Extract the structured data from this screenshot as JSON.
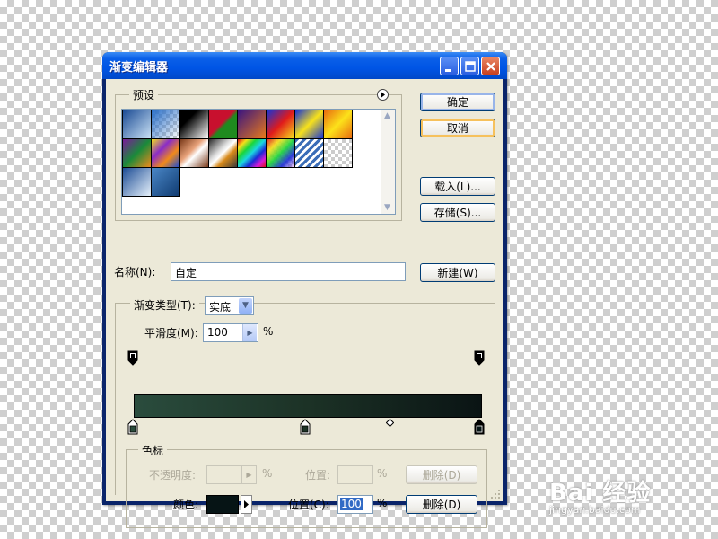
{
  "window": {
    "title": "渐变编辑器",
    "controls": [
      "minimize",
      "maximize",
      "close"
    ]
  },
  "presets": {
    "group_label": "预设",
    "menu_icon": "right-arrow-circle-icon",
    "swatches": [
      "blue-white",
      "transparent-checker",
      "black-white",
      "red-green",
      "violet-orange",
      "blue-red-yellow",
      "blue-yellow-blue",
      "orange-yellow-orange",
      "violet-green-orange",
      "yellow-violet-orange-blue",
      "copper",
      "chrome",
      "spectrum",
      "transparent-rainbow",
      "transparent-stripes",
      "blue-checker",
      "blue-white-2",
      "steel-blue"
    ]
  },
  "buttons": {
    "ok": "确定",
    "cancel": "取消",
    "load": "载入(L)...",
    "save": "存储(S)...",
    "new": "新建(W)"
  },
  "name": {
    "label": "名称(N):",
    "value": "自定"
  },
  "gradient": {
    "type_label": "渐变类型(T):",
    "type_value": "实底",
    "smoothness_label": "平滑度(M):",
    "smoothness_value": "100",
    "smoothness_unit": "%",
    "colors": {
      "start": "#2a4c3d",
      "mid": "#1c3226",
      "end": "#0a1414"
    }
  },
  "color_stops": {
    "group_label": "色标",
    "opacity_label": "不透明度:",
    "opacity_value": "",
    "opacity_unit": "%",
    "opacity_location_label": "位置:",
    "opacity_location_value": "",
    "opacity_location_unit": "%",
    "opacity_delete": "删除(D)",
    "color_label": "颜色:",
    "color_value": "#061415",
    "location_label": "位置(C):",
    "location_value": "100",
    "location_unit": "%",
    "color_delete": "删除(D)"
  },
  "watermark": {
    "text": "Bai 经验",
    "sub": "jingyan.baidu.com"
  }
}
